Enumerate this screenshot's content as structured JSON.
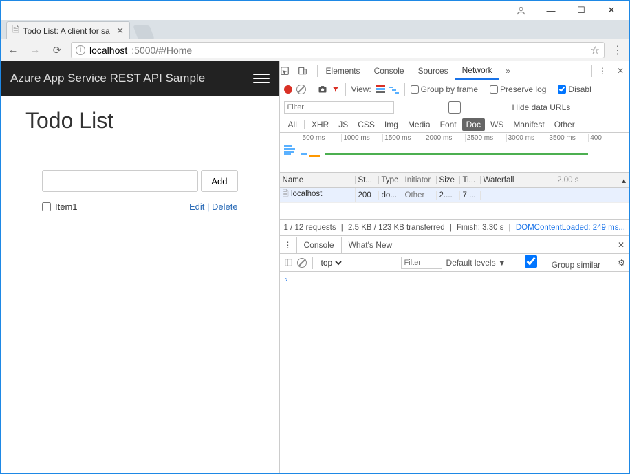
{
  "window": {
    "tab_title": "Todo List: A client for sa",
    "url_host": "localhost",
    "url_port_path": ":5000/#/Home"
  },
  "page": {
    "brand": "Azure App Service REST API Sample",
    "heading": "Todo List",
    "add_button": "Add",
    "todo_input_value": "",
    "items": [
      {
        "text": "Item1",
        "checked": false
      }
    ],
    "edit_label": "Edit",
    "delete_label": "Delete",
    "action_sep": " | "
  },
  "devtools": {
    "panels": {
      "elements": "Elements",
      "console": "Console",
      "sources": "Sources",
      "network": "Network"
    },
    "toolbar": {
      "view_label": "View:",
      "group_by_frame": "Group by frame",
      "preserve_log": "Preserve log",
      "disable_cache": "Disabl",
      "group_checked": false,
      "preserve_checked": false,
      "disable_checked": true
    },
    "filter": {
      "placeholder": "Filter",
      "hide_data_urls": "Hide data URLs",
      "hide_checked": false
    },
    "types": [
      "All",
      "XHR",
      "JS",
      "CSS",
      "Img",
      "Media",
      "Font",
      "Doc",
      "WS",
      "Manifest",
      "Other"
    ],
    "type_selected": "Doc",
    "timeline_ticks": [
      "500 ms",
      "1000 ms",
      "1500 ms",
      "2000 ms",
      "2500 ms",
      "3000 ms",
      "3500 ms",
      "400"
    ],
    "table": {
      "headers": {
        "name": "Name",
        "status": "St...",
        "type": "Type",
        "initiator": "Initiator",
        "size": "Size",
        "time": "Ti...",
        "waterfall": "Waterfall",
        "wf_scale": "2.00 s"
      },
      "rows": [
        {
          "name": "localhost",
          "status": "200",
          "type": "do...",
          "initiator": "Other",
          "size": "2....",
          "time": "7 ..."
        }
      ]
    },
    "status": {
      "requests": "1 / 12 requests",
      "transferred": "2.5 KB / 123 KB transferred",
      "finish": "Finish: 3.30 s",
      "dcl": "DOMContentLoaded: 249 ms..."
    },
    "drawer": {
      "tab_console": "Console",
      "tab_whatsnew": "What's New",
      "context": "top",
      "filter_placeholder": "Filter",
      "levels": "Default levels ▼",
      "group_similar": "Group similar",
      "group_similar_checked": true,
      "prompt": "›"
    }
  }
}
